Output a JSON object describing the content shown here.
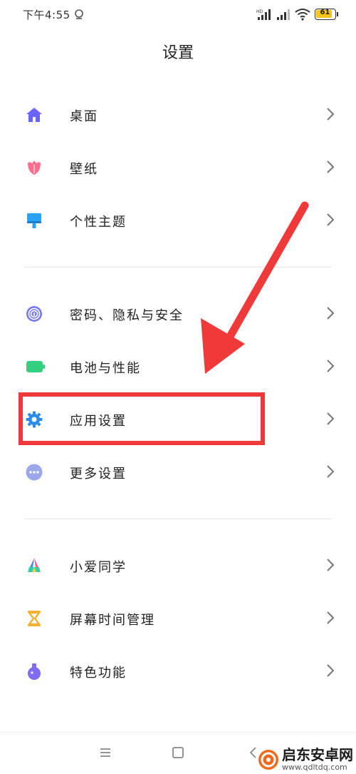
{
  "status_bar": {
    "time": "下午4:55",
    "battery": "61"
  },
  "header": {
    "title": "设置"
  },
  "groups": [
    {
      "items": [
        {
          "label": "桌面",
          "icon": "home-icon",
          "color": "#6b63ff"
        },
        {
          "label": "壁纸",
          "icon": "tulip-icon",
          "color": "#ff6f8e"
        },
        {
          "label": "个性主题",
          "icon": "brush-icon",
          "color": "#2aa3f4"
        }
      ]
    },
    {
      "items": [
        {
          "label": "密码、隐私与安全",
          "icon": "fingerprint-icon",
          "color": "#7b7cf0"
        },
        {
          "label": "电池与性能",
          "icon": "battery-icon",
          "color": "#35d07f"
        },
        {
          "label": "应用设置",
          "icon": "gear-icon",
          "color": "#2b8de8"
        },
        {
          "label": "更多设置",
          "icon": "more-icon",
          "color": "#9ba7e8"
        }
      ]
    },
    {
      "items": [
        {
          "label": "小爱同学",
          "icon": "xiaoai-icon",
          "color": "#4b7bf5"
        },
        {
          "label": "屏幕时间管理",
          "icon": "hourglass-icon",
          "color": "#f3b234"
        },
        {
          "label": "特色功能",
          "icon": "flask-icon",
          "color": "#7f6cf2"
        }
      ]
    }
  ],
  "annotation": {
    "color": "#f03a3a"
  },
  "watermark": {
    "title": "启东安卓网",
    "url": "www.qdltdq.com"
  }
}
